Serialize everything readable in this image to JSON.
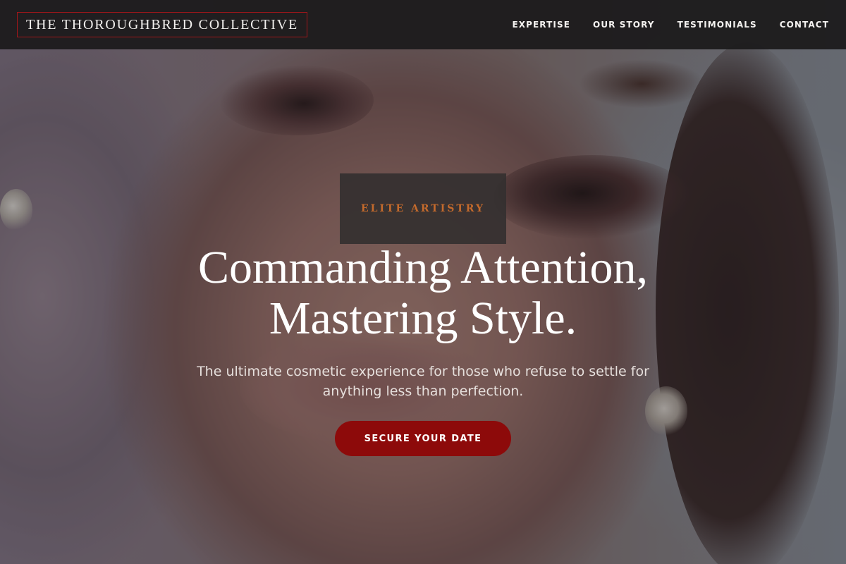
{
  "header": {
    "logo_text": "THE THOROUGHBRED COLLECTIVE",
    "nav": [
      {
        "label": "EXPERTISE"
      },
      {
        "label": "OUR STORY"
      },
      {
        "label": "TESTIMONIALS"
      },
      {
        "label": "CONTACT"
      }
    ]
  },
  "hero": {
    "eyebrow": "ELITE ARTISTRY",
    "headline_line1": "Commanding Attention,",
    "headline_line2": "Mastering Style.",
    "subtext": "The ultimate cosmetic experience for those who refuse to settle for anything less than perfection.",
    "cta_label": "SECURE YOUR DATE",
    "background_image": "close-up portrait of a woman with dramatic winged eyeliner and rose-toned eyeshadow"
  },
  "colors": {
    "accent_red": "#8d0a0a",
    "logo_border": "#a3161a",
    "eyebrow_orange": "#c46a2c",
    "header_bg": "#1c1b1c"
  }
}
